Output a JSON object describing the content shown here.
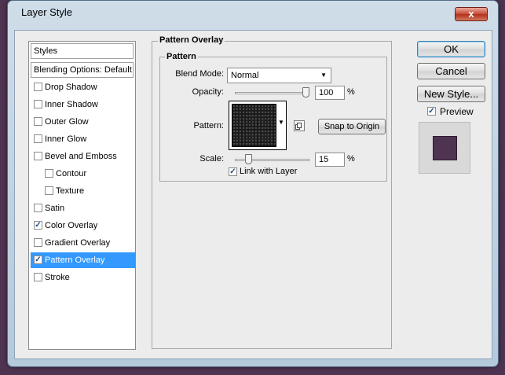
{
  "window": {
    "title": "Layer Style",
    "close_label": "x"
  },
  "styles_list": {
    "header_styles": "Styles",
    "header_blending": "Blending Options: Default",
    "items": [
      {
        "label": "Drop Shadow",
        "checked": false,
        "indent": false,
        "selected": false,
        "key": "drop-shadow"
      },
      {
        "label": "Inner Shadow",
        "checked": false,
        "indent": false,
        "selected": false,
        "key": "inner-shadow"
      },
      {
        "label": "Outer Glow",
        "checked": false,
        "indent": false,
        "selected": false,
        "key": "outer-glow"
      },
      {
        "label": "Inner Glow",
        "checked": false,
        "indent": false,
        "selected": false,
        "key": "inner-glow"
      },
      {
        "label": "Bevel and Emboss",
        "checked": false,
        "indent": false,
        "selected": false,
        "key": "bevel-and-emboss"
      },
      {
        "label": "Contour",
        "checked": false,
        "indent": true,
        "selected": false,
        "key": "contour"
      },
      {
        "label": "Texture",
        "checked": false,
        "indent": true,
        "selected": false,
        "key": "texture"
      },
      {
        "label": "Satin",
        "checked": false,
        "indent": false,
        "selected": false,
        "key": "satin"
      },
      {
        "label": "Color Overlay",
        "checked": true,
        "indent": false,
        "selected": false,
        "key": "color-overlay"
      },
      {
        "label": "Gradient Overlay",
        "checked": false,
        "indent": false,
        "selected": false,
        "key": "gradient-overlay"
      },
      {
        "label": "Pattern Overlay",
        "checked": true,
        "indent": false,
        "selected": true,
        "key": "pattern-overlay"
      },
      {
        "label": "Stroke",
        "checked": false,
        "indent": false,
        "selected": false,
        "key": "stroke"
      }
    ]
  },
  "panel": {
    "title": "Pattern Overlay",
    "group_title": "Pattern",
    "blend_mode_label": "Blend Mode:",
    "blend_mode_value": "Normal",
    "opacity_label": "Opacity:",
    "opacity_value": "100",
    "opacity_percent": 100,
    "percent_sign": "%",
    "pattern_label": "Pattern:",
    "snap_button": "Snap to Origin",
    "scale_label": "Scale:",
    "scale_value": "15",
    "scale_percent": 15,
    "link_label": "Link with Layer",
    "link_checked": true
  },
  "buttons": {
    "ok": "OK",
    "cancel": "Cancel",
    "new_style": "New Style..."
  },
  "preview": {
    "label": "Preview",
    "checked": true,
    "swatch_color": "#4f3452"
  },
  "icons": {
    "check": "✓",
    "dropdown": "▼"
  },
  "colors": {
    "selection": "#3399ff",
    "background": "#4f3452"
  }
}
